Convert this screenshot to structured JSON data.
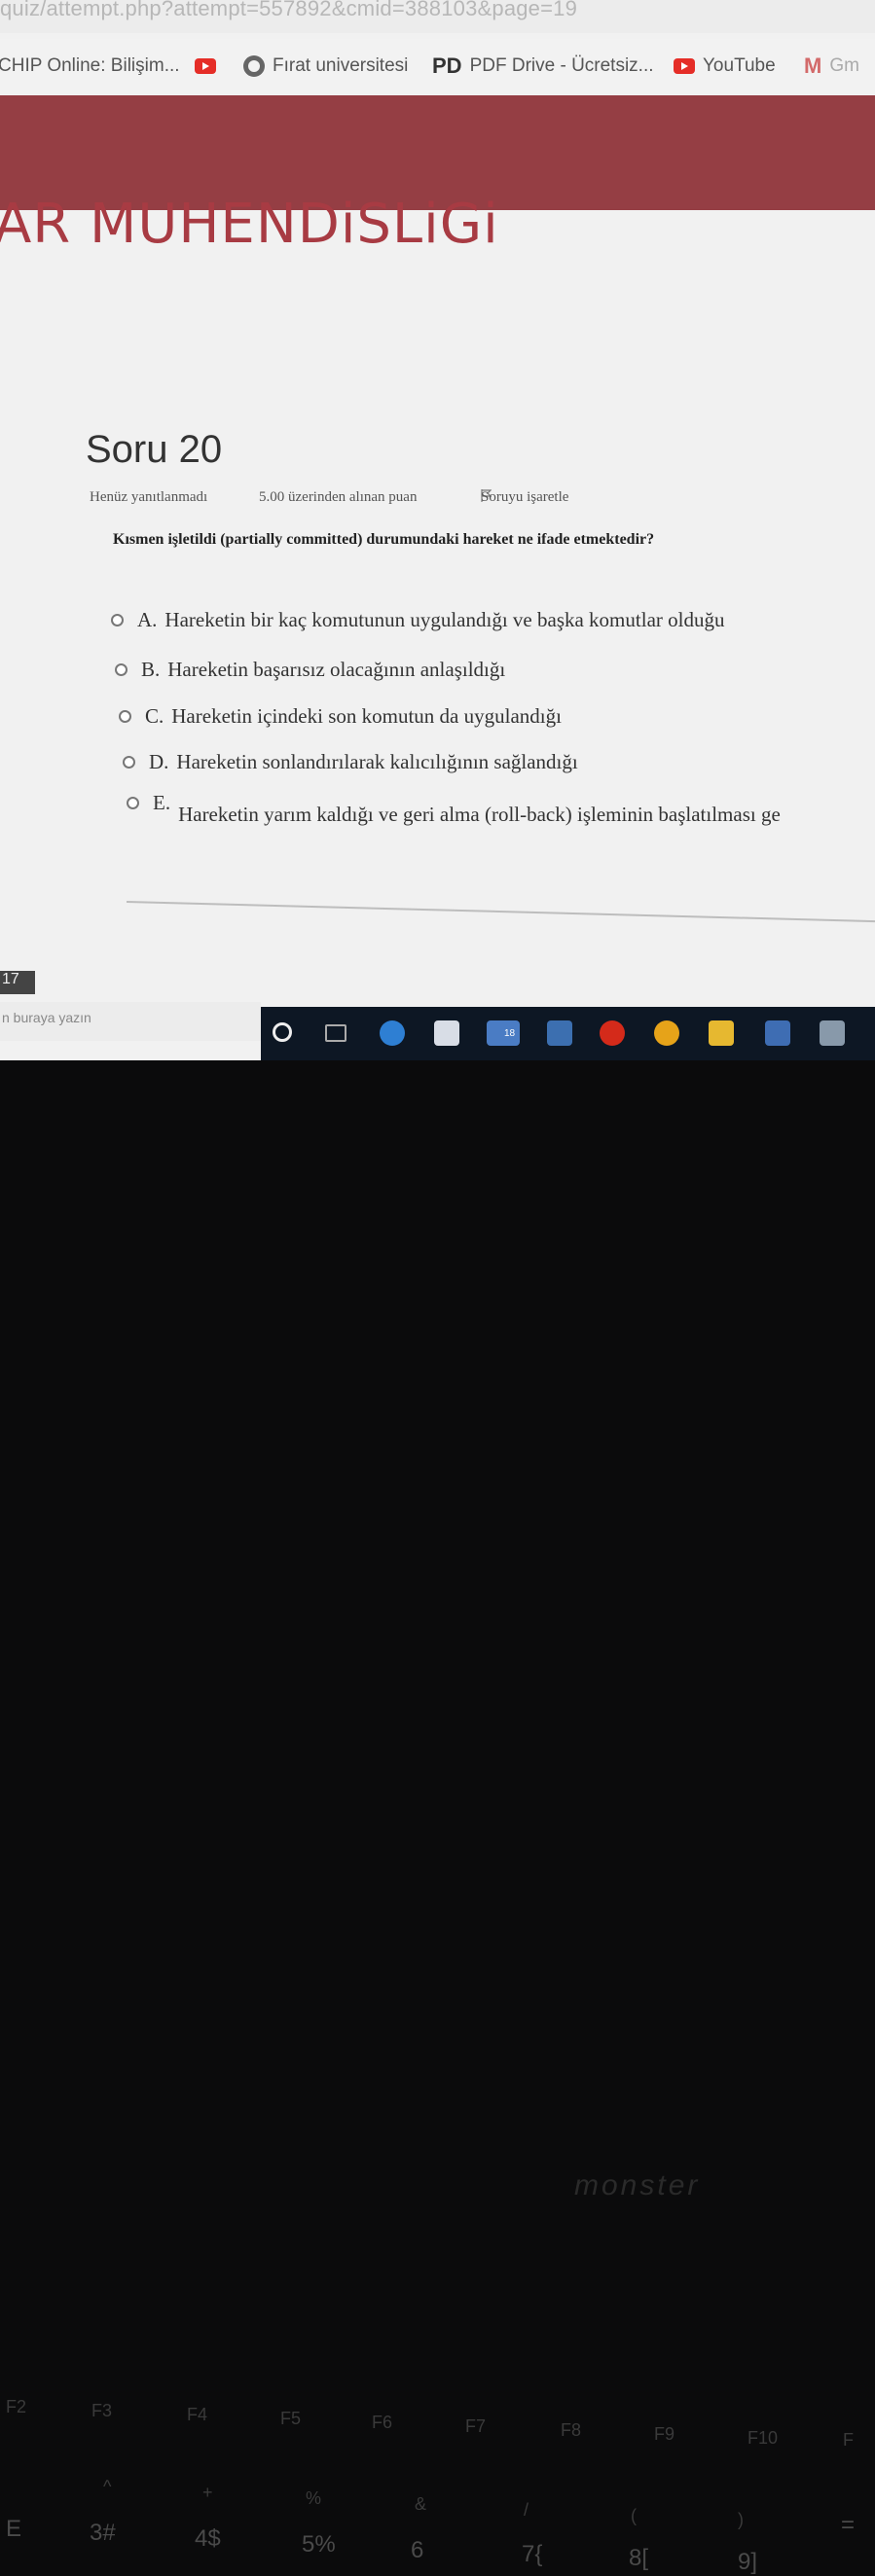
{
  "browser": {
    "url": "quiz/attempt.php?attempt=557892&cmid=388103&page=19",
    "bookmarks": [
      {
        "label": "CHIP Online: Bilişim...",
        "icon": "none"
      },
      {
        "label": "",
        "icon": "youtube-icon"
      },
      {
        "label": "Fırat universitesi",
        "icon": "globe-icon"
      },
      {
        "label": "PDF Drive - Ücretsiz...",
        "icon": "pd-icon",
        "icon_text": "PD"
      },
      {
        "label": "YouTube",
        "icon": "youtube-icon"
      },
      {
        "label": "Gm",
        "icon": "gmail-icon",
        "icon_text": "M"
      }
    ]
  },
  "site": {
    "title": "AR MUHENDiSLiGi",
    "banner_color": "#953e44"
  },
  "question": {
    "title": "Soru 20",
    "status": "Henüz yanıtlanmadı",
    "points": "5.00 üzerinden alınan puan",
    "flag_label": "Soruyu işaretle",
    "text": "Kısmen işletildi (partially committed) durumundaki hareket ne ifade etmektedir?",
    "options": [
      {
        "letter": "A.",
        "text": "Hareketin bir kaç komutunun uygulandığı ve başka komutlar olduğu"
      },
      {
        "letter": "B.",
        "text": "Hareketin başarısız olacağının anlaşıldığı"
      },
      {
        "letter": "C.",
        "text": "Hareketin içindeki son komutun da uygulandığı"
      },
      {
        "letter": "D.",
        "text": "Hareketin sonlandırılarak kalıcılığının sağlandığı"
      },
      {
        "letter": "E.",
        "text": "Hareketin yarım kaldığı ve geri alma (roll-back) işleminin başlatılması ge"
      }
    ]
  },
  "taskbar": {
    "clock": "17",
    "search_placeholder": "n buraya yazın",
    "mail_badge": "18"
  },
  "keyboard": {
    "brand": "monster",
    "fn_keys": [
      "F2",
      "F3",
      "F4",
      "F5",
      "F6",
      "F7",
      "F8",
      "F9",
      "F10",
      "F"
    ],
    "num_keys": [
      "E",
      "3#",
      "4$",
      "5%",
      "6",
      "7{",
      "8[",
      "9]",
      "="
    ],
    "symbols": [
      "^",
      "+",
      "%",
      "&",
      "/",
      "(",
      ")"
    ]
  }
}
